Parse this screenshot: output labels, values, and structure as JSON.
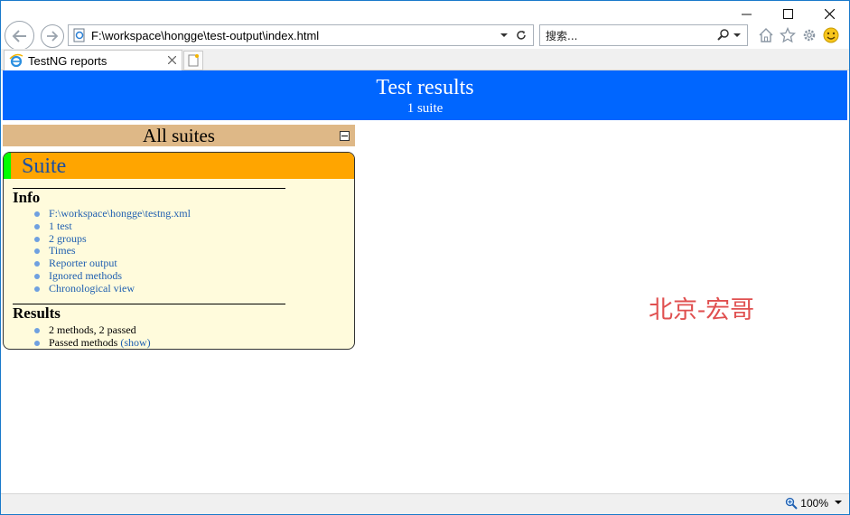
{
  "browser": {
    "address": "F:\\workspace\\hongge\\test-output\\index.html",
    "search_placeholder": "搜索...",
    "tab_title": "TestNG reports",
    "zoom": "100%",
    "icons": [
      "back-arrow-icon",
      "forward-arrow-icon",
      "page-icon",
      "dropdown-icon",
      "refresh-icon",
      "search-icon",
      "home-icon",
      "star-icon",
      "gear-icon",
      "smiley-icon",
      "ie-logo-icon",
      "new-tab-icon",
      "zoom-icon"
    ]
  },
  "banner": {
    "title": "Test results",
    "subtitle": "1 suite",
    "color": "#0066ff"
  },
  "suites": {
    "header": "All suites",
    "header_color": "#deb887"
  },
  "suite": {
    "name": "Suite",
    "head_color": "#ffa500",
    "stripe_color": "#00ff00",
    "info_title": "Info",
    "info_items": [
      "F:\\workspace\\hongge\\testng.xml",
      "1 test",
      "2 groups",
      "Times",
      "Reporter output",
      "Ignored methods",
      "Chronological view"
    ],
    "results_title": "Results",
    "results_summary": "2 methods, 2 passed",
    "passed_label": "Passed methods",
    "show_label": "(show)"
  },
  "watermark": "北京-宏哥"
}
